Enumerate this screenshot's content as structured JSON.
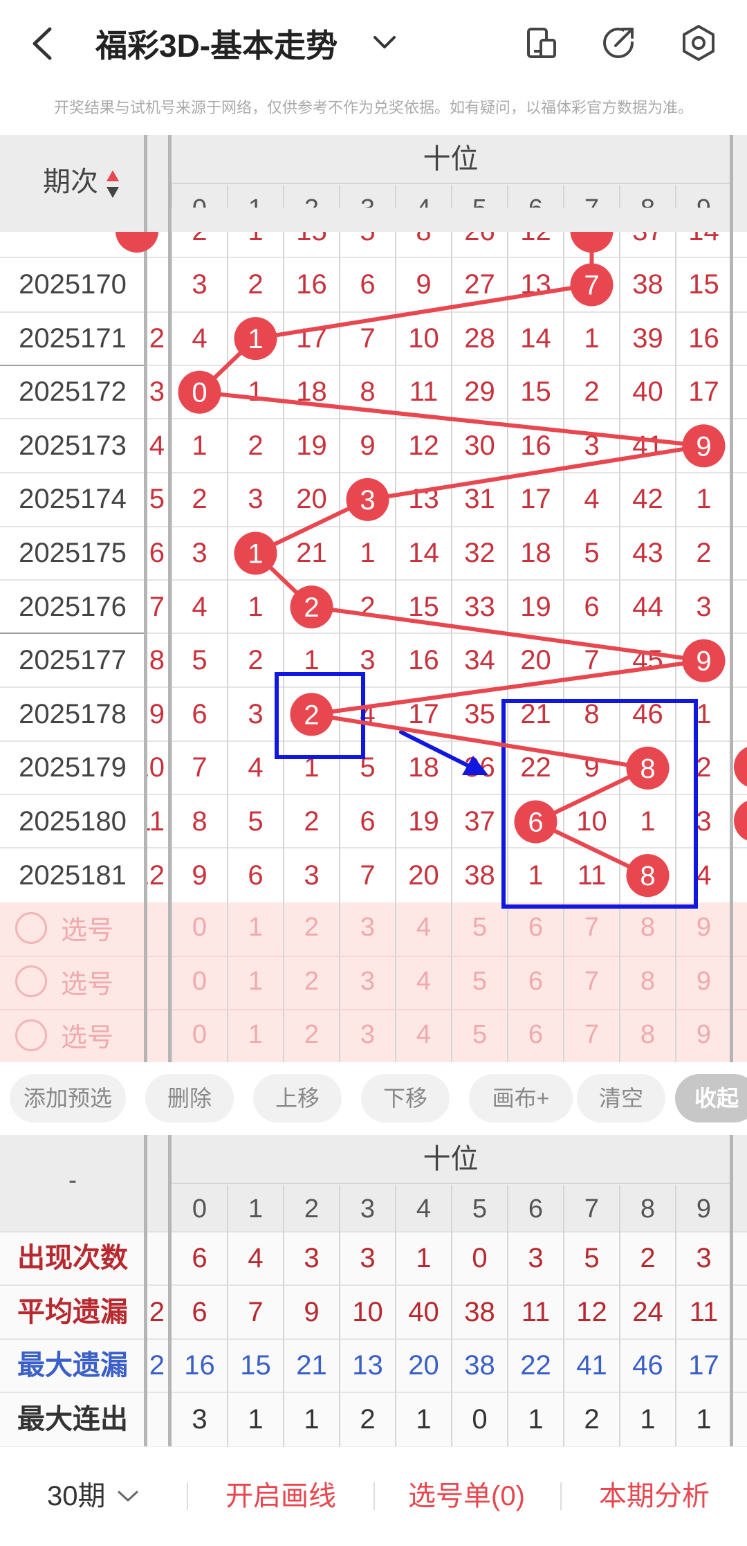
{
  "header": {
    "back_icon": "chevron-left-icon",
    "title": "福彩3D-基本走势",
    "dropdown_icon": "chevron-down-icon",
    "icons": [
      "device-layout-icon",
      "share-icon",
      "settings-icon"
    ]
  },
  "disclaimer": "开奖结果与试机号来源于网络，仅供参考不作为兑奖依据。如有疑问，以福体彩官方数据为准。",
  "table": {
    "period_header": "期次",
    "section_header": "十位",
    "digits": [
      "0",
      "1",
      "2",
      "3",
      "4",
      "5",
      "6",
      "7",
      "8",
      "9"
    ],
    "partial_row": {
      "values": [
        "2",
        "1",
        "15",
        "5",
        "8",
        "26",
        "12",
        "7",
        "37",
        "14"
      ],
      "hit_index": 7
    },
    "rows": [
      {
        "period": "2025170",
        "left_clip": "",
        "values": [
          "3",
          "2",
          "16",
          "6",
          "9",
          "27",
          "13",
          "7",
          "38",
          "15"
        ],
        "hit_index": 7
      },
      {
        "period": "2025171",
        "left_clip": "2",
        "values": [
          "4",
          "1",
          "17",
          "7",
          "10",
          "28",
          "14",
          "1",
          "39",
          "16"
        ],
        "hit_index": 1
      },
      {
        "period": "2025172",
        "left_clip": "3",
        "values": [
          "0",
          "1",
          "18",
          "8",
          "11",
          "29",
          "15",
          "2",
          "40",
          "17"
        ],
        "hit_index": 0
      },
      {
        "period": "2025173",
        "left_clip": "4",
        "values": [
          "1",
          "2",
          "19",
          "9",
          "12",
          "30",
          "16",
          "3",
          "41",
          "9"
        ],
        "hit_index": 9
      },
      {
        "period": "2025174",
        "left_clip": "5",
        "values": [
          "2",
          "3",
          "20",
          "3",
          "13",
          "31",
          "17",
          "4",
          "42",
          "1"
        ],
        "hit_index": 3
      },
      {
        "period": "2025175",
        "left_clip": "6",
        "values": [
          "3",
          "1",
          "21",
          "1",
          "14",
          "32",
          "18",
          "5",
          "43",
          "2"
        ],
        "hit_index": 1
      },
      {
        "period": "2025176",
        "left_clip": "7",
        "values": [
          "4",
          "1",
          "2",
          "2",
          "15",
          "33",
          "19",
          "6",
          "44",
          "3"
        ],
        "hit_index": 2
      },
      {
        "period": "2025177",
        "left_clip": "8",
        "values": [
          "5",
          "2",
          "1",
          "3",
          "16",
          "34",
          "20",
          "7",
          "45",
          "9"
        ],
        "hit_index": 9
      },
      {
        "period": "2025178",
        "left_clip": "9",
        "values": [
          "6",
          "3",
          "2",
          "4",
          "17",
          "35",
          "21",
          "8",
          "46",
          "1"
        ],
        "hit_index": 2
      },
      {
        "period": "2025179",
        "left_clip": "10",
        "values": [
          "7",
          "4",
          "1",
          "5",
          "18",
          "36",
          "22",
          "9",
          "8",
          "2"
        ],
        "hit_index": 8
      },
      {
        "period": "2025180",
        "left_clip": "11",
        "values": [
          "8",
          "5",
          "2",
          "6",
          "19",
          "37",
          "6",
          "10",
          "1",
          "3"
        ],
        "hit_index": 6
      },
      {
        "period": "2025181",
        "left_clip": "12",
        "values": [
          "9",
          "6",
          "3",
          "7",
          "20",
          "38",
          "1",
          "11",
          "8",
          "4"
        ],
        "hit_index": 8
      }
    ],
    "pick_rows": [
      {
        "label": "选号"
      },
      {
        "label": "选号"
      },
      {
        "label": "选号"
      }
    ]
  },
  "toolbar": {
    "buttons": [
      "添加预选",
      "删除",
      "上移",
      "下移",
      "画布+",
      "清空",
      "收起"
    ]
  },
  "stats": {
    "corner": "-",
    "section_header": "十位",
    "digits": [
      "0",
      "1",
      "2",
      "3",
      "4",
      "5",
      "6",
      "7",
      "8",
      "9"
    ],
    "rows": [
      {
        "label": "出现次数",
        "color": "#b8282f",
        "left_clip": "",
        "values": [
          "6",
          "4",
          "3",
          "3",
          "1",
          "0",
          "3",
          "5",
          "2",
          "3"
        ]
      },
      {
        "label": "平均遗漏",
        "color": "#b8282f",
        "left_clip": "2",
        "values": [
          "6",
          "7",
          "9",
          "10",
          "40",
          "38",
          "11",
          "12",
          "24",
          "11"
        ]
      },
      {
        "label": "最大遗漏",
        "color": "#3a5fc8",
        "left_clip": "2",
        "values": [
          "16",
          "15",
          "21",
          "13",
          "20",
          "38",
          "22",
          "41",
          "46",
          "17"
        ]
      },
      {
        "label": "最大连出",
        "color": "#333333",
        "left_clip": "",
        "values": [
          "3",
          "1",
          "1",
          "2",
          "1",
          "0",
          "1",
          "2",
          "1",
          "1"
        ]
      }
    ]
  },
  "bottom": {
    "period_select": "30期",
    "draw_line": "开启画线",
    "pick_list": "选号单(0)",
    "analysis": "本期分析"
  },
  "colors": {
    "accent_red": "#e8474f",
    "annotation_blue": "#1018e0",
    "stats_blue": "#3a5fc8"
  }
}
